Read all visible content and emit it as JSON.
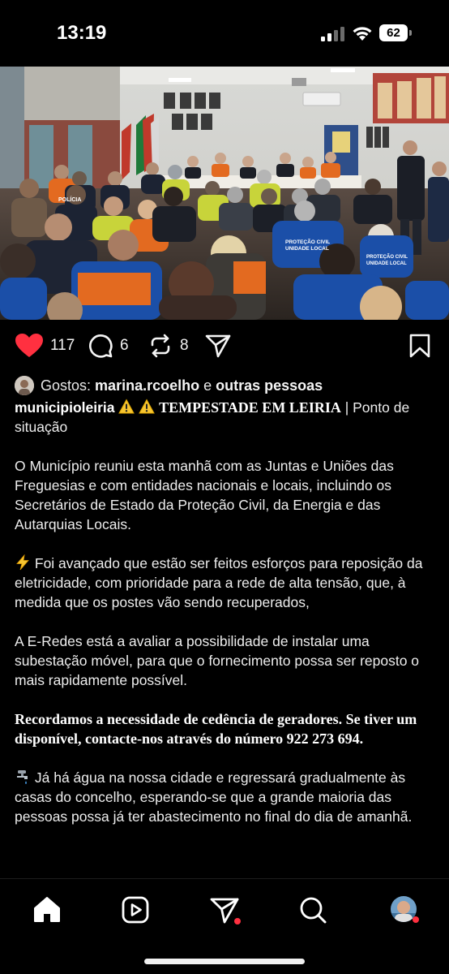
{
  "status_bar": {
    "time": "13:19",
    "battery": "62"
  },
  "post": {
    "like_count": "117",
    "comment_count": "6",
    "repost_count": "8",
    "likes_prefix": "Gostos:",
    "liked_by_user": "marina.rcoelho",
    "likes_joiner": "e",
    "likes_others": "outras pessoas",
    "author": "municipioleiria",
    "headline": "TEMPESTADE EM LEIRIA",
    "headline_sep": "|",
    "headline_rest": "Ponto de situação",
    "paragraph_1": "O Município reuniu esta manhã com as Juntas e Uniões das Freguesias e com entidades nacionais e locais, incluindo os Secretários de Estado da Proteção Civil, da Energia e das Autarquias Locais.",
    "paragraph_2": "Foi avançado que estão ser feitos esforços para reposição da eletricidade, com prioridade para a rede de alta tensão, que, à medida que os postes vão sendo recuperados,",
    "paragraph_3": "A E-Redes está a avaliar a possibilidade de instalar uma subestação móvel, para que o fornecimento possa ser reposto o mais rapidamente possível.",
    "paragraph_4": "Recordamos a necessidade de cedência de geradores. Se tiver um disponível, contacte-nos através do número 922 273 694.",
    "paragraph_5": "Já há água na nossa cidade e regressará gradualmente às casas do concelho, esperando-se que a grande maioria das pessoas possa já ter abastecimento no final do dia de amanhã."
  },
  "photo": {
    "vest_text_1": "PROTEÇÃO CIVIL",
    "vest_text_2": "UNIDADE LOCAL",
    "vest_text_3": "POLÍCIA"
  },
  "icons": {
    "like": "heart-icon",
    "comment": "comment-icon",
    "repost": "repost-icon",
    "share": "send-icon",
    "save": "bookmark-icon",
    "nav": [
      "home-icon",
      "reels-icon",
      "send-icon",
      "search-icon",
      "profile-avatar"
    ]
  },
  "colors": {
    "background": "#000000",
    "like": "#ff3040",
    "notification_dot": "#ff3040",
    "text": "#f5f5f5"
  }
}
